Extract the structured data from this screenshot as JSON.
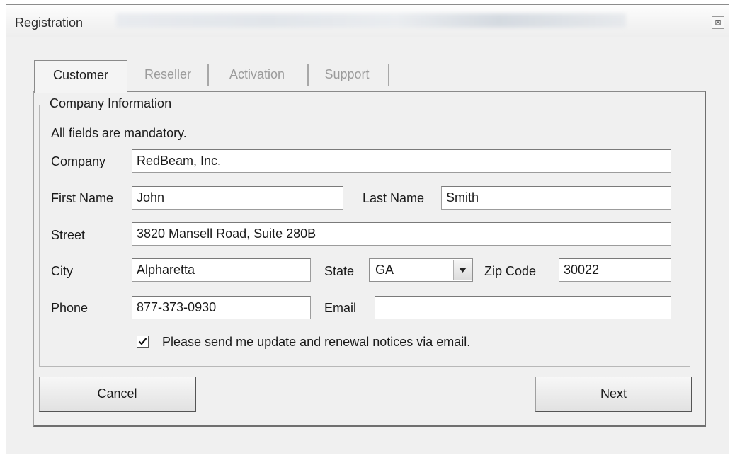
{
  "window": {
    "title": "Registration",
    "close_symbol": "⊠"
  },
  "tabs": [
    {
      "label": "Customer",
      "active": true
    },
    {
      "label": "Reseller",
      "active": false
    },
    {
      "label": "Activation",
      "active": false
    },
    {
      "label": "Support",
      "active": false
    }
  ],
  "group": {
    "legend": "Company Information",
    "note": "All fields are mandatory."
  },
  "fields": {
    "company": {
      "label": "Company",
      "value": "RedBeam, Inc."
    },
    "first_name": {
      "label": "First Name",
      "value": "John"
    },
    "last_name": {
      "label": "Last Name",
      "value": "Smith"
    },
    "street": {
      "label": "Street",
      "value": "3820 Mansell Road, Suite 280B"
    },
    "city": {
      "label": "City",
      "value": "Alpharetta"
    },
    "state": {
      "label": "State",
      "value": "GA"
    },
    "zip": {
      "label": "Zip Code",
      "value": "30022"
    },
    "phone": {
      "label": "Phone",
      "value": "877-373-0930"
    },
    "email": {
      "label": "Email",
      "value": ""
    }
  },
  "notices": {
    "label": "Please send me update and renewal notices via email.",
    "checked": true
  },
  "buttons": {
    "cancel": "Cancel",
    "next": "Next"
  }
}
